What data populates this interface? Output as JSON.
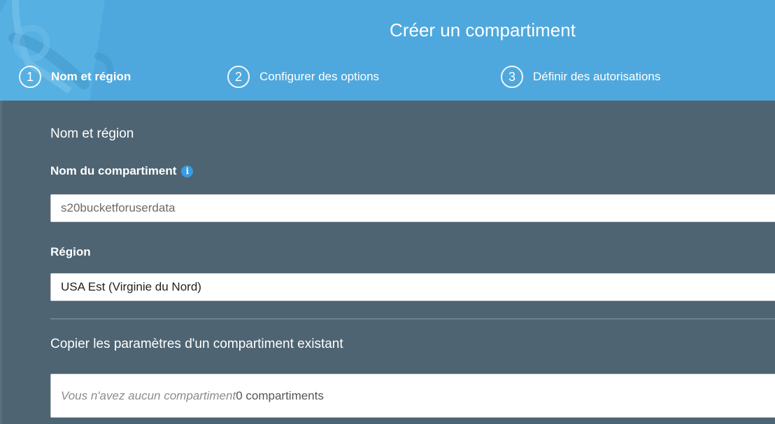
{
  "wizard": {
    "title": "Créer un compartiment",
    "steps": [
      {
        "number": "1",
        "label": "Nom et région",
        "active": true
      },
      {
        "number": "2",
        "label": "Configurer des options",
        "active": false
      },
      {
        "number": "3",
        "label": "Définir des autorisations",
        "active": false
      }
    ]
  },
  "form": {
    "section_title": "Nom et région",
    "bucket_name_label": "Nom du compartiment",
    "bucket_name_value": "s20bucketforuserdata",
    "region_label": "Région",
    "region_value": "USA Est (Virginie du Nord)",
    "copy_section_title": "Copier les paramètres d'un compartiment existant",
    "copy_empty_text": "Vous n'avez aucun compartiment",
    "copy_count_text": "0 compartiments"
  },
  "colors": {
    "header_bg": "#4ea8dd",
    "body_bg": "#4e6472",
    "info_icon": "#3b9be0"
  },
  "icons": {
    "info": "info-icon",
    "header_decoration": "bucket-illustration"
  }
}
